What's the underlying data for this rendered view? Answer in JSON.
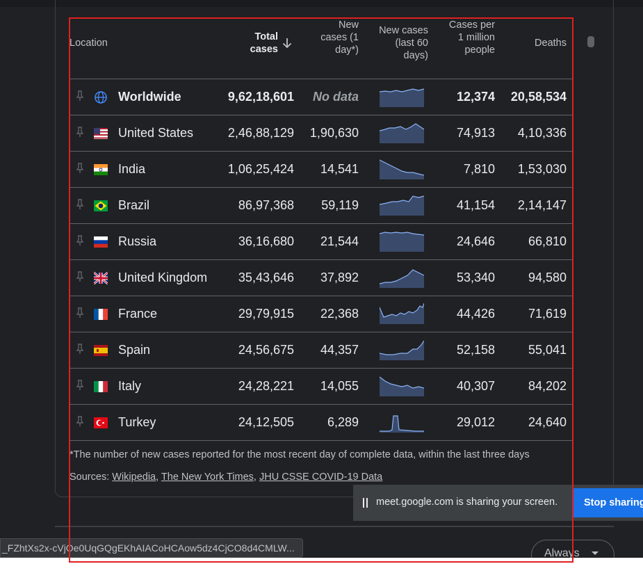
{
  "table": {
    "headers": {
      "location": "Location",
      "total_cases": "Total cases",
      "new_cases": "New cases (1 day*)",
      "new_cases_60": "New cases (last 60 days)",
      "cases_per_million": "Cases per 1 million people",
      "deaths": "Deaths"
    },
    "sort_indicator": "arrow-down-icon",
    "rows": [
      {
        "name": "Worldwide",
        "flag": "globe-icon",
        "total": "9,62,18,601",
        "new": "No data",
        "per_million": "12,374",
        "deaths": "20,58,534"
      },
      {
        "name": "United States",
        "flag": "us-flag-icon",
        "total": "2,46,88,129",
        "new": "1,90,630",
        "per_million": "74,913",
        "deaths": "4,10,336"
      },
      {
        "name": "India",
        "flag": "india-flag-icon",
        "total": "1,06,25,424",
        "new": "14,541",
        "per_million": "7,810",
        "deaths": "1,53,030"
      },
      {
        "name": "Brazil",
        "flag": "brazil-flag-icon",
        "total": "86,97,368",
        "new": "59,119",
        "per_million": "41,154",
        "deaths": "2,14,147"
      },
      {
        "name": "Russia",
        "flag": "russia-flag-icon",
        "total": "36,16,680",
        "new": "21,544",
        "per_million": "24,646",
        "deaths": "66,810"
      },
      {
        "name": "United Kingdom",
        "flag": "uk-flag-icon",
        "total": "35,43,646",
        "new": "37,892",
        "per_million": "53,340",
        "deaths": "94,580"
      },
      {
        "name": "France",
        "flag": "france-flag-icon",
        "total": "29,79,915",
        "new": "22,368",
        "per_million": "44,426",
        "deaths": "71,619"
      },
      {
        "name": "Spain",
        "flag": "spain-flag-icon",
        "total": "24,56,675",
        "new": "44,357",
        "per_million": "52,158",
        "deaths": "55,041"
      },
      {
        "name": "Italy",
        "flag": "italy-flag-icon",
        "total": "24,28,221",
        "new": "14,055",
        "per_million": "40,307",
        "deaths": "84,202"
      },
      {
        "name": "Turkey",
        "flag": "turkey-flag-icon",
        "total": "24,12,505",
        "new": "6,289",
        "per_million": "29,012",
        "deaths": "24,640"
      }
    ]
  },
  "footnote": "*The number of new cases reported for the most recent day of complete data, within the last three days",
  "sources": {
    "label": "Sources:",
    "links": [
      "Wikipedia",
      "The New York Times",
      "JHU CSSE COVID-19 Data"
    ]
  },
  "screen_share": {
    "message": "meet.google.com is sharing your screen.",
    "stop_label": "Stop sharing"
  },
  "status_url": "_FZhtXs2x-cVjOe0UqGQgEKhAIACoHCAow5dz4CjCO8d4CMLW...",
  "always_button": "Always",
  "colors": {
    "background": "#202124",
    "accent": "#1a73e8",
    "highlight_frame": "#e0201f",
    "sparkline_fill": "#3a4a6b",
    "sparkline_stroke": "#8ab4f8"
  }
}
